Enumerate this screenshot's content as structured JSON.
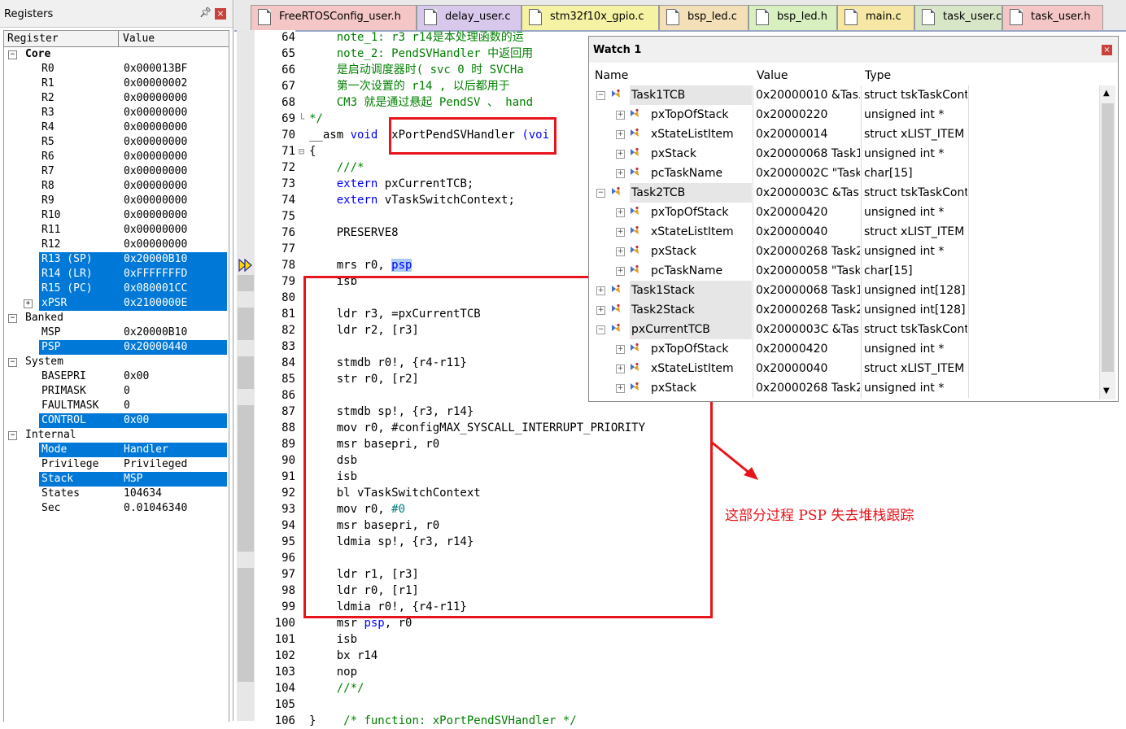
{
  "registers": {
    "title": "Registers",
    "col_register": "Register",
    "col_value": "Value",
    "rows": [
      {
        "name": "Core",
        "value": "",
        "level": 0,
        "group": true,
        "bold": true
      },
      {
        "name": "R0",
        "value": "0x000013BF",
        "level": 2
      },
      {
        "name": "R1",
        "value": "0x00000002",
        "level": 2
      },
      {
        "name": "R2",
        "value": "0x00000000",
        "level": 2
      },
      {
        "name": "R3",
        "value": "0x00000000",
        "level": 2
      },
      {
        "name": "R4",
        "value": "0x00000000",
        "level": 2
      },
      {
        "name": "R5",
        "value": "0x00000000",
        "level": 2
      },
      {
        "name": "R6",
        "value": "0x00000000",
        "level": 2
      },
      {
        "name": "R7",
        "value": "0x00000000",
        "level": 2
      },
      {
        "name": "R8",
        "value": "0x00000000",
        "level": 2
      },
      {
        "name": "R9",
        "value": "0x00000000",
        "level": 2
      },
      {
        "name": "R10",
        "value": "0x00000000",
        "level": 2
      },
      {
        "name": "R11",
        "value": "0x00000000",
        "level": 2
      },
      {
        "name": "R12",
        "value": "0x00000000",
        "level": 2
      },
      {
        "name": "R13 (SP)",
        "value": "0x20000B10",
        "level": 2,
        "selected": true
      },
      {
        "name": "R14 (LR)",
        "value": "0xFFFFFFFD",
        "level": 2,
        "selected": true
      },
      {
        "name": "R15 (PC)",
        "value": "0x080001CC",
        "level": 2,
        "selected": true
      },
      {
        "name": "xPSR",
        "value": "0x2100000E",
        "level": 2,
        "selected": true,
        "expander": "+"
      },
      {
        "name": "Banked",
        "value": "",
        "level": 0,
        "group": true
      },
      {
        "name": "MSP",
        "value": "0x20000B10",
        "level": 2
      },
      {
        "name": "PSP",
        "value": "0x20000440",
        "level": 2,
        "selected": true
      },
      {
        "name": "System",
        "value": "",
        "level": 0,
        "group": true
      },
      {
        "name": "BASEPRI",
        "value": "0x00",
        "level": 2
      },
      {
        "name": "PRIMASK",
        "value": "0",
        "level": 2
      },
      {
        "name": "FAULTMASK",
        "value": "0",
        "level": 2
      },
      {
        "name": "CONTROL",
        "value": "0x00",
        "level": 2,
        "selected": true
      },
      {
        "name": "Internal",
        "value": "",
        "level": 0,
        "group": true
      },
      {
        "name": "Mode",
        "value": "Handler",
        "level": 2,
        "selected": true
      },
      {
        "name": "Privilege",
        "value": "Privileged",
        "level": 2
      },
      {
        "name": "Stack",
        "value": "MSP",
        "level": 2,
        "selected": true
      },
      {
        "name": "States",
        "value": "104634",
        "level": 2
      },
      {
        "name": "Sec",
        "value": "0.01046340",
        "level": 2
      }
    ]
  },
  "tabs": [
    {
      "label": "FreeRTOSConfig_user.h",
      "color": "#f4c6c6"
    },
    {
      "label": "delay_user.c",
      "color": "#d8c8ec"
    },
    {
      "label": "stm32f10x_gpio.c",
      "color": "#f6f2a4"
    },
    {
      "label": "bsp_led.c",
      "color": "#f3dfb8"
    },
    {
      "label": "bsp_led.h",
      "color": "#d8f0c0"
    },
    {
      "label": "main.c",
      "color": "#f6e8a4"
    },
    {
      "label": "task_user.c",
      "color": "#d8e6c8"
    },
    {
      "label": "task_user.h",
      "color": "#f4c6c6"
    }
  ],
  "editor": {
    "lines": [
      {
        "n": "64",
        "segs": [
          [
            "    ",
            ""
          ],
          [
            "note_1: r3 r14是本处理函数的运",
            "cmt"
          ]
        ]
      },
      {
        "n": "65",
        "segs": [
          [
            "    ",
            ""
          ],
          [
            "note_2: PendSVHandler 中返回用",
            "cmt"
          ]
        ]
      },
      {
        "n": "66",
        "segs": [
          [
            "    ",
            ""
          ],
          [
            "是启动调度器时( svc 0 时 SVCHa",
            "cmt"
          ]
        ]
      },
      {
        "n": "67",
        "segs": [
          [
            "    ",
            ""
          ],
          [
            "第一次设置的 r14 , 以后都用于",
            "cmt"
          ]
        ]
      },
      {
        "n": "68",
        "segs": [
          [
            "    ",
            ""
          ],
          [
            "CM3 就是通过悬起 PendSV 、 hand",
            "cmt"
          ]
        ]
      },
      {
        "n": "69",
        "segs": [
          [
            "*/",
            "cmt"
          ]
        ]
      },
      {
        "n": "70",
        "segs": [
          [
            "__asm ",
            ""
          ],
          [
            "void",
            "kw"
          ],
          [
            "  xPortPendSVHandler ",
            ""
          ],
          [
            "(voi",
            "kw"
          ]
        ]
      },
      {
        "n": "71",
        "segs": [
          [
            "{",
            ""
          ]
        ]
      },
      {
        "n": "72",
        "segs": [
          [
            "    ",
            ""
          ],
          [
            "///*",
            "cmt"
          ]
        ]
      },
      {
        "n": "73",
        "segs": [
          [
            "    ",
            ""
          ],
          [
            "extern",
            "kw"
          ],
          [
            " pxCurrentTCB;",
            ""
          ]
        ]
      },
      {
        "n": "74",
        "segs": [
          [
            "    ",
            ""
          ],
          [
            "extern",
            "kw"
          ],
          [
            " vTaskSwitchContext;",
            ""
          ]
        ]
      },
      {
        "n": "75",
        "segs": [
          [
            "",
            ""
          ]
        ]
      },
      {
        "n": "76",
        "segs": [
          [
            "    PRESERVE8",
            ""
          ]
        ]
      },
      {
        "n": "77",
        "segs": [
          [
            "",
            ""
          ]
        ]
      },
      {
        "n": "78",
        "segs": [
          [
            "    mrs r0, ",
            ""
          ],
          [
            "psp",
            "psp"
          ]
        ]
      },
      {
        "n": "79",
        "segs": [
          [
            "    isb",
            ""
          ]
        ]
      },
      {
        "n": "80",
        "segs": [
          [
            "",
            ""
          ]
        ]
      },
      {
        "n": "81",
        "segs": [
          [
            "    ldr r3, =pxCurrentTCB",
            ""
          ]
        ]
      },
      {
        "n": "82",
        "segs": [
          [
            "    ldr r2, [r3]",
            ""
          ]
        ]
      },
      {
        "n": "83",
        "segs": [
          [
            "",
            ""
          ]
        ]
      },
      {
        "n": "84",
        "segs": [
          [
            "    stmdb r0!, {r4-r11}",
            ""
          ]
        ]
      },
      {
        "n": "85",
        "segs": [
          [
            "    str r0, [r2]",
            ""
          ]
        ]
      },
      {
        "n": "86",
        "segs": [
          [
            "",
            ""
          ]
        ]
      },
      {
        "n": "87",
        "segs": [
          [
            "    stmdb sp!, {r3, r14}",
            ""
          ]
        ]
      },
      {
        "n": "88",
        "segs": [
          [
            "    mov r0, #configMAX_SYSCALL_INTERRUPT_PRIORITY",
            ""
          ]
        ]
      },
      {
        "n": "89",
        "segs": [
          [
            "    msr basepri, r0",
            ""
          ]
        ]
      },
      {
        "n": "90",
        "segs": [
          [
            "    dsb",
            ""
          ]
        ]
      },
      {
        "n": "91",
        "segs": [
          [
            "    isb",
            ""
          ]
        ]
      },
      {
        "n": "92",
        "segs": [
          [
            "    bl vTaskSwitchContext",
            ""
          ]
        ]
      },
      {
        "n": "93",
        "segs": [
          [
            "    mov r0, ",
            ""
          ],
          [
            "#0",
            "num"
          ]
        ]
      },
      {
        "n": "94",
        "segs": [
          [
            "    msr basepri, r0",
            ""
          ]
        ]
      },
      {
        "n": "95",
        "segs": [
          [
            "    ldmia sp!, {r3, r14}",
            ""
          ]
        ]
      },
      {
        "n": "96",
        "segs": [
          [
            "",
            ""
          ]
        ]
      },
      {
        "n": "97",
        "segs": [
          [
            "    ldr r1, [r3]",
            ""
          ]
        ]
      },
      {
        "n": "98",
        "segs": [
          [
            "    ldr r0, [r1]",
            ""
          ]
        ]
      },
      {
        "n": "99",
        "segs": [
          [
            "    ldmia r0!, {r4-r11}",
            ""
          ]
        ]
      },
      {
        "n": "100",
        "segs": [
          [
            "    msr ",
            ""
          ],
          [
            "psp",
            "kwu"
          ],
          [
            ", r0",
            ""
          ]
        ]
      },
      {
        "n": "101",
        "segs": [
          [
            "    isb",
            ""
          ]
        ]
      },
      {
        "n": "102",
        "segs": [
          [
            "    bx r14",
            ""
          ]
        ]
      },
      {
        "n": "103",
        "segs": [
          [
            "    nop",
            ""
          ]
        ]
      },
      {
        "n": "104",
        "segs": [
          [
            "    ",
            ""
          ],
          [
            "//*/",
            "cmt"
          ]
        ]
      },
      {
        "n": "105",
        "segs": [
          [
            "",
            ""
          ]
        ]
      },
      {
        "n": "106",
        "segs": [
          [
            "}    ",
            ""
          ],
          [
            "/* function: xPortPendSVHandler */",
            "cmt"
          ]
        ]
      }
    ]
  },
  "watch": {
    "title": "Watch 1",
    "col_name": "Name",
    "col_value": "Value",
    "col_type": "Type",
    "rows": [
      {
        "name": "Task1TCB",
        "value": "0x20000010 &Tas...",
        "type": "struct tskTaskCont...",
        "level": 0,
        "expander": "−"
      },
      {
        "name": "pxTopOfStack",
        "value": "0x20000220",
        "type": "unsigned int *",
        "level": 1,
        "expander": "+"
      },
      {
        "name": "xStateListItem",
        "value": "0x20000014",
        "type": "struct xLIST_ITEM",
        "level": 1,
        "expander": "+"
      },
      {
        "name": "pxStack",
        "value": "0x20000068 Task1...",
        "type": "unsigned int *",
        "level": 1,
        "expander": "+"
      },
      {
        "name": "pcTaskName",
        "value": "0x2000002C \"Task...",
        "type": "char[15]",
        "level": 1,
        "expander": "+"
      },
      {
        "name": "Task2TCB",
        "value": "0x2000003C &Tas...",
        "type": "struct tskTaskCont...",
        "level": 0,
        "expander": "−"
      },
      {
        "name": "pxTopOfStack",
        "value": "0x20000420",
        "type": "unsigned int *",
        "level": 1,
        "expander": "+"
      },
      {
        "name": "xStateListItem",
        "value": "0x20000040",
        "type": "struct xLIST_ITEM",
        "level": 1,
        "expander": "+"
      },
      {
        "name": "pxStack",
        "value": "0x20000268 Task2...",
        "type": "unsigned int *",
        "level": 1,
        "expander": "+"
      },
      {
        "name": "pcTaskName",
        "value": "0x20000058 \"Task...",
        "type": "char[15]",
        "level": 1,
        "expander": "+"
      },
      {
        "name": "Task1Stack",
        "value": "0x20000068 Task1...",
        "type": "unsigned int[128]",
        "level": 0,
        "expander": "+"
      },
      {
        "name": "Task2Stack",
        "value": "0x20000268 Task2...",
        "type": "unsigned int[128]",
        "level": 0,
        "expander": "+"
      },
      {
        "name": "pxCurrentTCB",
        "value": "0x2000003C &Tas...",
        "type": "struct tskTaskCont...",
        "level": 0,
        "expander": "−"
      },
      {
        "name": "pxTopOfStack",
        "value": "0x20000420",
        "type": "unsigned int *",
        "level": 1,
        "expander": "+"
      },
      {
        "name": "xStateListItem",
        "value": "0x20000040",
        "type": "struct xLIST_ITEM",
        "level": 1,
        "expander": "+"
      },
      {
        "name": "pxStack",
        "value": "0x20000268 Task2...",
        "type": "unsigned int *",
        "level": 1,
        "expander": "+"
      }
    ]
  },
  "annotation": {
    "text": "这部分过程 PSP 失去堆栈跟踪",
    "color": "#e8141b"
  },
  "icons": {
    "close": "close-icon",
    "pin": "pin-icon",
    "current_line": "current-line-arrow-icon",
    "variable": "watch-variable-icon"
  }
}
